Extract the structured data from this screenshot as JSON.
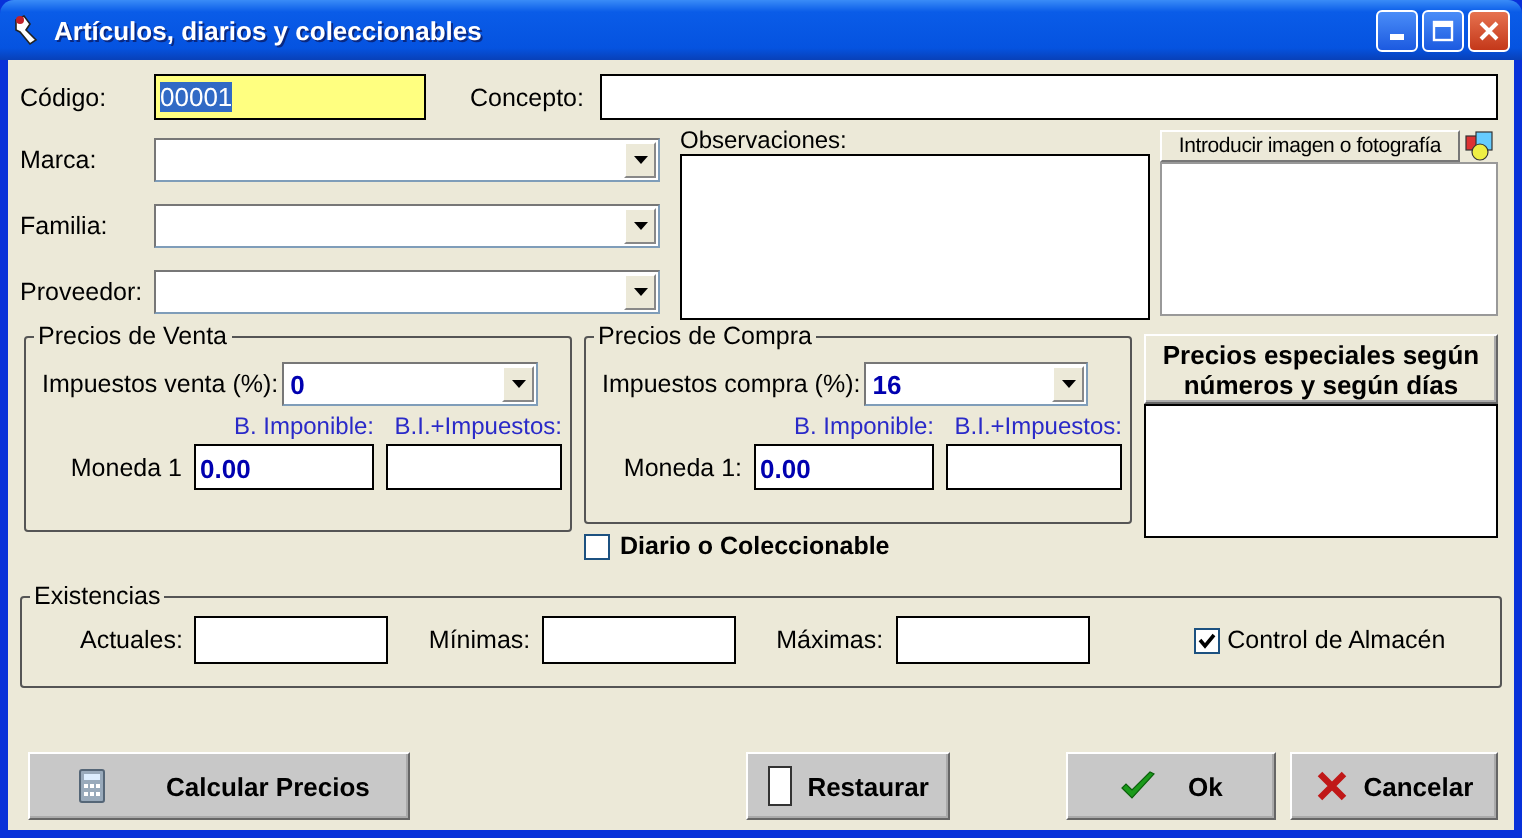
{
  "window": {
    "title": "Artículos, diarios y coleccionables"
  },
  "codigo": {
    "label": "Código:",
    "value": "00001",
    "text_selected": true
  },
  "concepto": {
    "label": "Concepto:"
  },
  "combos": [
    {
      "label": "Marca:"
    },
    {
      "label": "Familia:"
    },
    {
      "label": "Proveedor:"
    }
  ],
  "observaciones": {
    "label": "Observaciones:"
  },
  "photo": {
    "button": "Introducir imagen o fotografía"
  },
  "venta": {
    "title": "Precios de Venta",
    "tax_label": "Impuestos venta (%):",
    "tax_value": "0",
    "col1": "B. Imponible:",
    "col2": "B.I.+Impuestos:",
    "row_label": "Moneda 1",
    "base_value": "0.00"
  },
  "compra": {
    "title": "Precios de Compra",
    "tax_label": "Impuestos compra (%):",
    "tax_value": "16",
    "col1": "B. Imponible:",
    "col2": "B.I.+Impuestos:",
    "row_label": "Moneda 1:",
    "base_value": "0.00"
  },
  "diario": {
    "label": "Diario o Coleccionable",
    "checked": false
  },
  "especiales": {
    "lines": [
      "Precios especiales según",
      "números y según días"
    ]
  },
  "existencias": {
    "title": "Existencias",
    "fields": [
      {
        "label": "Actuales:"
      },
      {
        "label": "Mínimas:"
      },
      {
        "label": "Máximas:"
      }
    ],
    "control": {
      "label": "Control de Almacén",
      "checked": true
    }
  },
  "buttons": [
    {
      "label": "Calcular Precios",
      "kind": "calculate"
    },
    {
      "label": "Restaurar",
      "kind": "restore"
    },
    {
      "label": "Ok",
      "kind": "ok"
    },
    {
      "label": "Cancelar",
      "kind": "cancel"
    }
  ]
}
